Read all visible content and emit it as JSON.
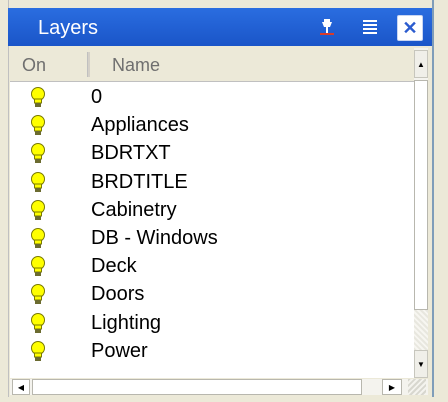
{
  "window": {
    "title": "Layers",
    "pin_icon": "pin-icon",
    "menu_icon": "menu-lines-icon",
    "close_icon": "close-icon",
    "title_color": "#1f5fd6"
  },
  "columns": {
    "on": "On",
    "name": "Name"
  },
  "layers": [
    {
      "name": "0",
      "on": true
    },
    {
      "name": "Appliances",
      "on": true
    },
    {
      "name": "BDRTXT",
      "on": true
    },
    {
      "name": "BRDTITLE",
      "on": true
    },
    {
      "name": "Cabinetry",
      "on": true
    },
    {
      "name": "DB - Windows",
      "on": true
    },
    {
      "name": "Deck",
      "on": true
    },
    {
      "name": "Doors",
      "on": true
    },
    {
      "name": "Lighting",
      "on": true
    },
    {
      "name": "Power",
      "on": true
    }
  ],
  "icons": {
    "layer_on": "lightbulb-on-icon",
    "bulb_color": "#ffff00"
  }
}
